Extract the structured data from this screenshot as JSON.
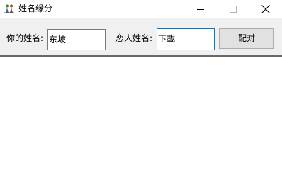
{
  "window": {
    "title": "姓名缘分",
    "icon": "couple-app-icon",
    "controls": {
      "minimize": "minimize-icon",
      "maximize": "maximize-icon",
      "close": "close-icon"
    }
  },
  "form": {
    "your_name_label": "你的姓名:",
    "your_name_value": "东坡",
    "lover_name_label": "恋人姓名:",
    "lover_name_value": "下載",
    "match_button_label": "配对"
  },
  "colors": {
    "toolbar_bg": "#f0f0f0",
    "focus_border": "#0078d7",
    "button_bg": "#e1e1e1",
    "divider": "#696969"
  }
}
